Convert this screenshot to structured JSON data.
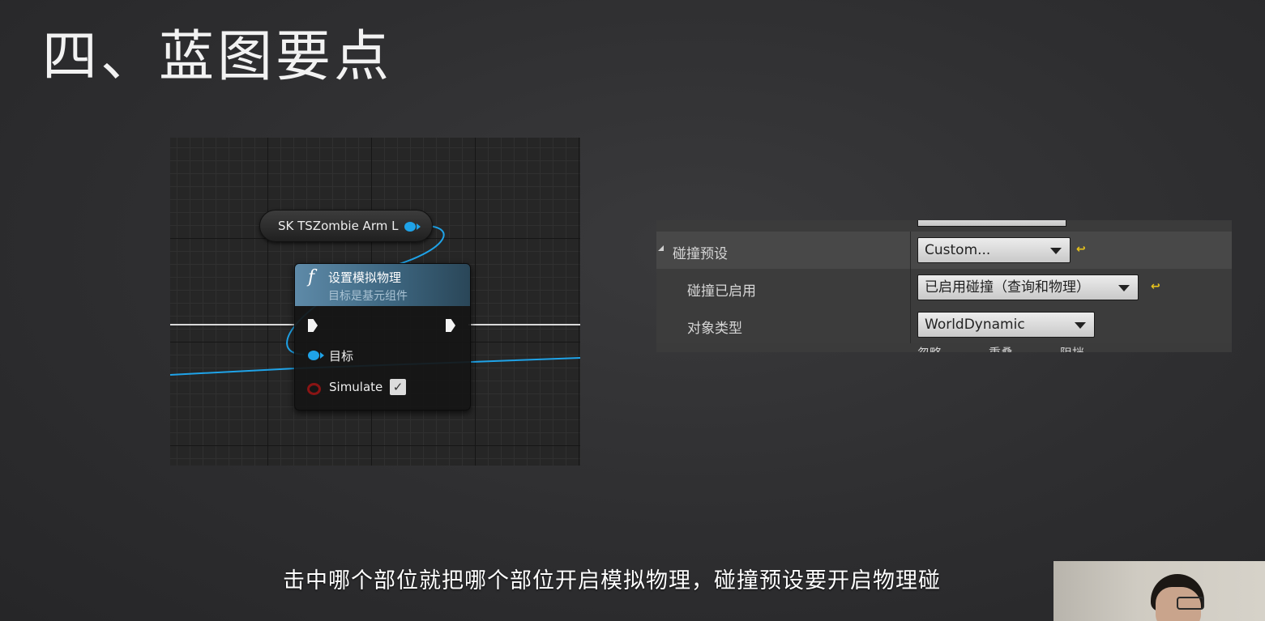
{
  "slide": {
    "title": "四、蓝图要点",
    "subtitle": "击中哪个部位就把哪个部位开启模拟物理，碰撞预设要开启物理碰"
  },
  "blueprint": {
    "variable_node": {
      "label": "SK TSZombie Arm L"
    },
    "function_node": {
      "icon": "f",
      "title": "设置模拟物理",
      "subtitle": "目标是基元组件",
      "target_pin_label": "目标",
      "simulate_pin_label": "Simulate",
      "simulate_checked": true,
      "check_mark": "✓"
    },
    "colors": {
      "object_wire": "#1fa3e8",
      "exec_wire": "#d9d9d9",
      "bool_pin": "#8a1414",
      "header": "#5e8aa8"
    }
  },
  "details_panel": {
    "rows": [
      {
        "label": "碰撞预设",
        "value": "Custom...",
        "has_reset": true,
        "expanded": true
      },
      {
        "label": "碰撞已启用",
        "value": "已启用碰撞（查询和物理）",
        "has_reset": true
      },
      {
        "label": "对象类型",
        "value": "WorldDynamic",
        "has_reset": false
      }
    ],
    "reset_icon": "reset-arrow-icon",
    "reset_glyph": "↩",
    "truncated_columns": [
      "忽略",
      "重叠",
      "阻挡"
    ]
  },
  "webcam": {
    "icon": "presenter-webcam"
  }
}
